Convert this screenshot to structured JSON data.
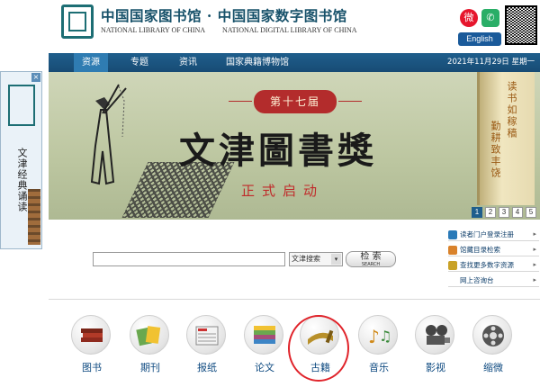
{
  "header": {
    "site_name_cn": "中国国家图书馆 · 中国国家数字图书馆",
    "site_name_en_1": "NATIONAL LIBRARY OF CHINA",
    "site_name_en_2": "NATIONAL DIGITAL LIBRARY OF CHINA",
    "english_label": "English",
    "weibo_icon": "weibo-icon",
    "wechat_icon": "wechat-icon"
  },
  "nav": {
    "items": [
      {
        "label": "资源",
        "active": true
      },
      {
        "label": "专题"
      },
      {
        "label": "资讯"
      },
      {
        "label": "国家典籍博物馆"
      }
    ],
    "date": "2021年11月29日  星期一"
  },
  "banner": {
    "badge": "第十七届",
    "title": "文津圖書獎",
    "subtitle": "正式启动",
    "book_text_1": "读书如稼穑",
    "book_text_2": "勤耕致丰饶",
    "pages": [
      "1",
      "2",
      "3",
      "4",
      "5"
    ],
    "active_page": "1"
  },
  "float_panel": {
    "text": "文津经典诵读",
    "close_label": "×"
  },
  "search": {
    "placeholder": "",
    "select_value": "文津搜索",
    "button_label": "检 索",
    "button_sub": "SEARCH"
  },
  "side_links": [
    {
      "label": "读者门户登录注册",
      "color": "#2a7ab8"
    },
    {
      "label": "馆藏目录检索",
      "color": "#d9822b"
    },
    {
      "label": "查找更多数字资源",
      "color": "#c9a227"
    },
    {
      "label": "网上咨询台",
      "color": "#ffffff"
    }
  ],
  "categories": [
    {
      "label": "图书",
      "icon": "books-icon"
    },
    {
      "label": "期刊",
      "icon": "journals-icon"
    },
    {
      "label": "报纸",
      "icon": "newspaper-icon"
    },
    {
      "label": "论文",
      "icon": "papers-icon"
    },
    {
      "label": "古籍",
      "icon": "ancient-books-icon"
    },
    {
      "label": "音乐",
      "icon": "music-icon"
    },
    {
      "label": "影视",
      "icon": "film-icon"
    },
    {
      "label": "缩微",
      "icon": "microfilm-icon"
    }
  ]
}
